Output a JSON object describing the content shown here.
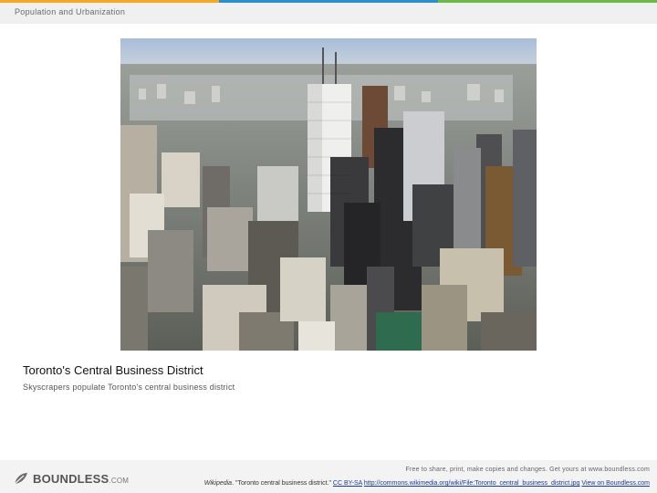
{
  "header": {
    "section_title": "Population and Urbanization",
    "accent_colors": [
      "#f5a623",
      "#2b8fd0",
      "#6bb944"
    ]
  },
  "figure": {
    "image_alt": "Aerial photograph of Toronto's downtown skyscrapers",
    "title": "Toronto's Central Business District",
    "description": "Skyscrapers populate Toronto's central business district"
  },
  "footer": {
    "logo_text": "BOUNDLESS",
    "logo_suffix": ".COM",
    "line1": "Free to share, print, make copies and changes. Get yours at www.boundless.com",
    "source": "Wikipedia",
    "quote": ". \"Toronto central business district.\"",
    "license": "CC BY-SA",
    "url": "http://commons.wikimedia.org/wiki/File:Toronto_central_business_district.jpg",
    "view_link": "View on Boundless.com"
  }
}
